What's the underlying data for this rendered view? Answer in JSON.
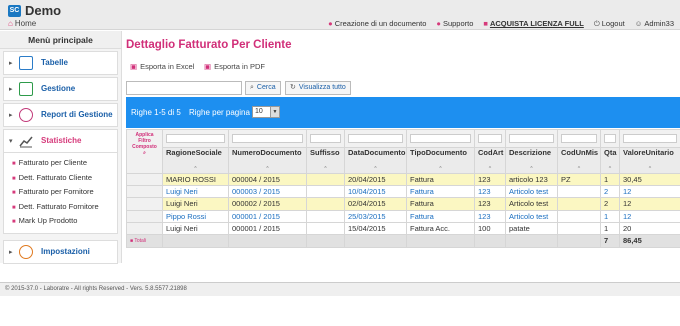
{
  "app": {
    "title": "Demo",
    "logo_text": "SC"
  },
  "breadcrumb": {
    "home": "Home"
  },
  "topbar": {
    "create_doc": "Creazione di un documento",
    "support": "Supporto",
    "buy": "ACQUISTA LICENZA FULL",
    "logout": "Logout",
    "user": "Admin33"
  },
  "sidebar": {
    "title": "Menù principale",
    "items": [
      {
        "label": "Tabelle",
        "icon": "table-icon"
      },
      {
        "label": "Gestione",
        "icon": "grid-icon"
      },
      {
        "label": "Report di Gestione",
        "icon": "pie-chart-icon"
      },
      {
        "label": "Statistiche",
        "icon": "bar-chart-icon"
      },
      {
        "label": "Impostazioni",
        "icon": "gear-icon"
      }
    ],
    "sub_items": [
      "Fatturato per Cliente",
      "Dett. Fatturato Cliente",
      "Fatturato per Fornitore",
      "Dett. Fatturato Fornitore",
      "Mark Up Prodotto"
    ]
  },
  "main": {
    "title": "Dettaglio Fatturato Per Cliente",
    "export_excel": "Esporta in Excel",
    "export_pdf": "Esporta in PDF",
    "search_value": "",
    "search_button": "Cerca",
    "show_all_button": "Visualizza tutto",
    "rows_info": "Righe 1-5 di 5",
    "per_page_label": "Righe per pagina",
    "per_page_value": "10",
    "filter_label": "Applica Filtro Composto",
    "columns": [
      "RagioneSociale",
      "NumeroDocumento",
      "Suffisso",
      "DataDocumento",
      "TipoDocumento",
      "CodArt",
      "Descrizione",
      "CodUnMis",
      "Qta",
      "ValoreUnitario"
    ],
    "rows": [
      [
        "MARIO ROSSI",
        "000004 / 2015",
        "",
        "20/04/2015",
        "Fattura",
        "123",
        "articolo 123",
        "PZ",
        "1",
        "30,45"
      ],
      [
        "Luigi Neri",
        "000003 / 2015",
        "",
        "10/04/2015",
        "Fattura",
        "123",
        "Articolo test",
        "",
        "2",
        "12"
      ],
      [
        "Luigi Neri",
        "000002 / 2015",
        "",
        "02/04/2015",
        "Fattura",
        "123",
        "Articolo test",
        "",
        "2",
        "12"
      ],
      [
        "Pippo Rossi",
        "000001 / 2015",
        "",
        "25/03/2015",
        "Fattura",
        "123",
        "Articolo test",
        "",
        "1",
        "12"
      ],
      [
        "Luigi Neri",
        "000001 / 2015",
        "",
        "15/04/2015",
        "Fattura Acc.",
        "100",
        "patate",
        "",
        "1",
        "20"
      ]
    ],
    "totals_label": "Totali",
    "totals": {
      "qta": "7",
      "valore": "86,45"
    }
  },
  "footer": {
    "text": "© 2015-37.0 - Laboratre - All rights Reserved - Vers. 5.8.5577.21898"
  },
  "colors": {
    "accent": "#d12f79",
    "blue": "#1d8ff0",
    "highlight": "#fbf7c2"
  }
}
